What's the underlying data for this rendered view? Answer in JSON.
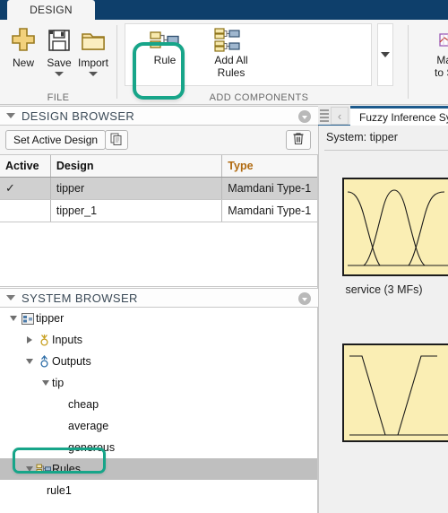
{
  "window": {
    "tab_label": "DESIGN"
  },
  "ribbon": {
    "groups": [
      {
        "name": "file",
        "label": "FILE",
        "buttons": [
          {
            "icon": "new-plus-icon",
            "label": "New",
            "has_caret": false
          },
          {
            "icon": "save-floppy-icon",
            "label": "Save",
            "has_caret": true
          },
          {
            "icon": "import-folder-icon",
            "label": "Import",
            "has_caret": true
          }
        ]
      },
      {
        "name": "add_components",
        "label": "ADD COMPONENTS",
        "buttons": [
          {
            "icon": "rule-icon",
            "label": "Rule",
            "highlighted": true
          },
          {
            "icon": "add-all-rules-icon",
            "label": "Add All\nRules",
            "label_line1": "Add All",
            "label_line2": "Rules",
            "highlighted": false
          }
        ],
        "overflow_caret": "chevron-down-icon"
      },
      {
        "name": "manage_truncated",
        "label": "",
        "buttons": [
          {
            "icon": "chart-icon",
            "label_line1": "Man",
            "label_line2": "to Su"
          }
        ]
      }
    ]
  },
  "design_browser": {
    "title": "DESIGN BROWSER",
    "collapse_icon": "triangle-down-icon",
    "header_action_icon": "panel-options-icon",
    "toolbar": {
      "set_active_label": "Set Active Design",
      "copy_icon": "copy-icon",
      "delete_icon": "trash-icon"
    },
    "table": {
      "columns": [
        "Active",
        "Design",
        "Type"
      ],
      "rows": [
        {
          "active": "✓",
          "design": "tipper",
          "type": "Mamdani Type-1",
          "selected": true
        },
        {
          "active": "",
          "design": "tipper_1",
          "type": "Mamdani Type-1",
          "selected": false
        }
      ]
    }
  },
  "system_browser": {
    "title": "SYSTEM BROWSER",
    "collapse_icon": "triangle-down-icon",
    "header_action_icon": "panel-options-icon",
    "tree": [
      {
        "label": "tipper",
        "depth": 0,
        "twisty": "down",
        "icon": "fis-system-icon",
        "selected": false
      },
      {
        "label": "Inputs",
        "depth": 1,
        "twisty": "right",
        "icon": "input-port-icon",
        "selected": false
      },
      {
        "label": "Outputs",
        "depth": 1,
        "twisty": "down",
        "icon": "output-port-icon",
        "selected": false
      },
      {
        "label": "tip",
        "depth": 2,
        "twisty": "down",
        "icon": "none",
        "selected": false
      },
      {
        "label": "cheap",
        "depth": 3,
        "twisty": "none",
        "icon": "none",
        "selected": false
      },
      {
        "label": "average",
        "depth": 3,
        "twisty": "none",
        "icon": "none",
        "selected": false
      },
      {
        "label": "generous",
        "depth": 3,
        "twisty": "none",
        "icon": "none",
        "selected": false
      },
      {
        "label": "Rules",
        "depth": 1,
        "twisty": "down",
        "icon": "rule-icon",
        "selected": true
      },
      {
        "label": "rule1",
        "depth": 2,
        "twisty": "none",
        "icon": "none",
        "selected": false
      }
    ]
  },
  "document": {
    "grip_icon": "drag-grip-icon",
    "back_icon": "chevron-left-icon",
    "tab_label": "Fuzzy Inference System",
    "system_label": "System: tipper",
    "plots": [
      {
        "caption": "service (3 MFs)",
        "mf_count": 3,
        "shape": "gaussian"
      },
      {
        "caption": "",
        "mf_count": 3,
        "shape": "trapezoidal"
      }
    ]
  },
  "colors": {
    "accent_blue": "#0e3f6b",
    "highlight_green": "#17a589",
    "mf_plot_fill": "#faeeb4",
    "selection_gray": "#bfbfbf",
    "panel_bg": "#f5f5f5"
  }
}
